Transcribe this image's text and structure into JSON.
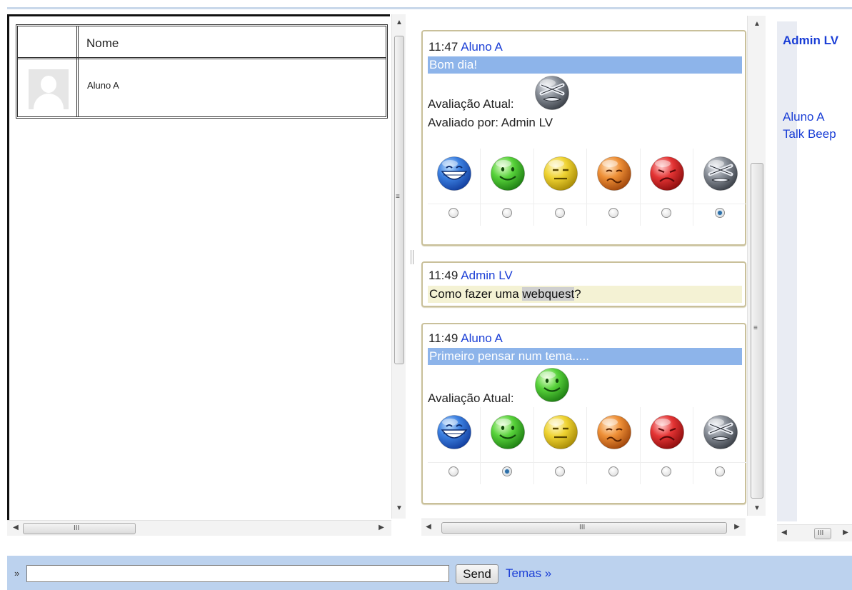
{
  "users_table": {
    "header": "Nome",
    "rows": [
      {
        "name": "Aluno A"
      }
    ]
  },
  "messages": [
    {
      "time": "11:47",
      "author": "Aluno A",
      "text": "Bom dia!",
      "rating_label": "Avaliação Atual:",
      "current_rating_icon": "angry-gray-face-icon",
      "rated_by": "Avaliado por: Admin LV",
      "selected_rating": 5
    },
    {
      "time": "11:49",
      "author": "Admin LV",
      "text_before": "Como fazer uma ",
      "text_highlight": "webquest",
      "text_after": "?"
    },
    {
      "time": "11:49",
      "author": "Aluno A",
      "text": "Primeiro pensar num tema.....",
      "rating_label": "Avaliação Atual:",
      "current_rating_icon": "smile-green-face-icon",
      "selected_rating": 1
    }
  ],
  "rating_scale": [
    {
      "icon": "grin-blue-face-icon",
      "color": "#2b67d1"
    },
    {
      "icon": "smile-green-face-icon",
      "color": "#3fbf2a"
    },
    {
      "icon": "neutral-yellow-face-icon",
      "color": "#e3c21c"
    },
    {
      "icon": "sad-orange-face-icon",
      "color": "#e07a1f"
    },
    {
      "icon": "frown-red-face-icon",
      "color": "#d82a2a"
    },
    {
      "icon": "angry-gray-face-icon",
      "color": "#6b7078"
    }
  ],
  "online_users": {
    "current_user": "Admin LV",
    "others": [
      {
        "name": "Aluno A",
        "status": "Talk Beep"
      }
    ]
  },
  "input_bar": {
    "prompt": "»",
    "value": "",
    "send_label": "Send",
    "topics_link": "Temas »"
  },
  "colors": {
    "link": "#1a3ed6",
    "selected_message": "#8db4ea",
    "own_message": "#f4f2d4",
    "bottom_bar": "#bcd2ee"
  }
}
